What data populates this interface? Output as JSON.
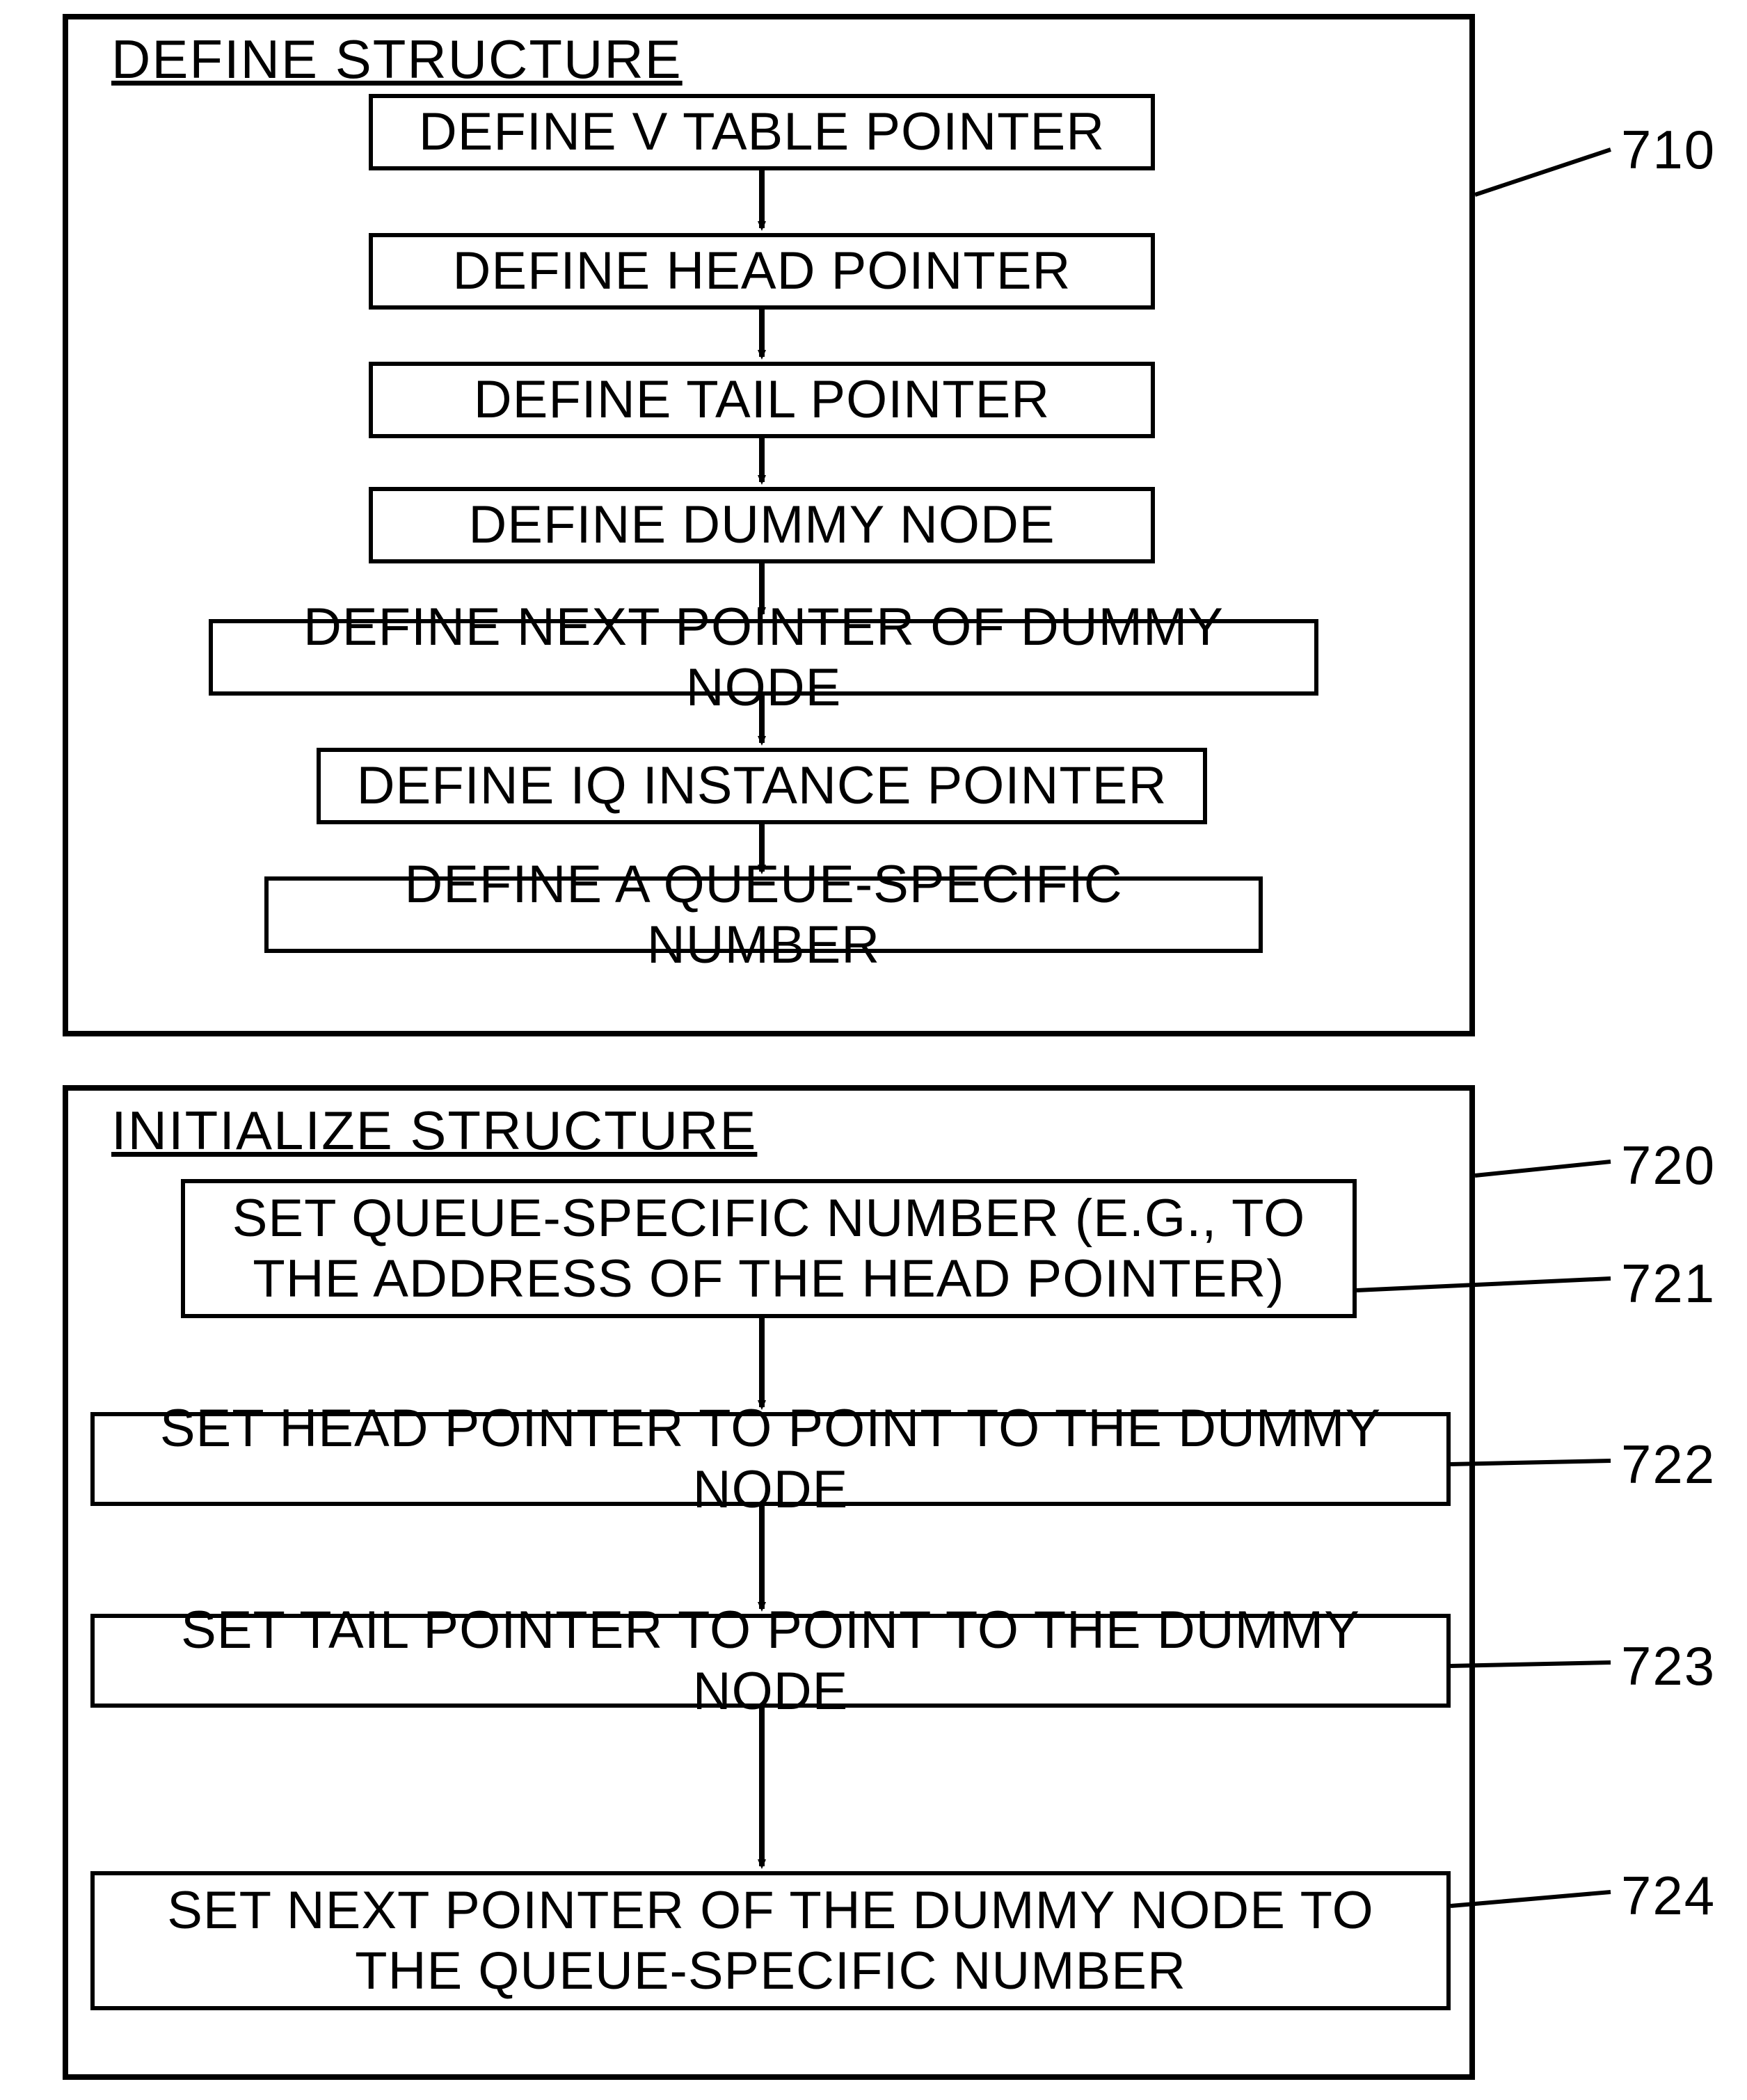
{
  "panel1": {
    "title": "DEFINE STRUCTURE",
    "callout": "710",
    "steps": {
      "s1": "DEFINE V TABLE POINTER",
      "s2": "DEFINE HEAD POINTER",
      "s3": "DEFINE TAIL POINTER",
      "s4": "DEFINE DUMMY NODE",
      "s5": "DEFINE NEXT POINTER OF DUMMY NODE",
      "s6": "DEFINE IQ INSTANCE POINTER",
      "s7": "DEFINE A QUEUE-SPECIFIC NUMBER"
    }
  },
  "panel2": {
    "title": "INITIALIZE STRUCTURE",
    "callouts": {
      "c720": "720",
      "c721": "721",
      "c722": "722",
      "c723": "723",
      "c724": "724"
    },
    "steps": {
      "s1": "SET QUEUE-SPECIFIC NUMBER (E.G., TO THE ADDRESS OF THE HEAD POINTER)",
      "s2": "SET HEAD POINTER TO POINT TO THE DUMMY  NODE",
      "s3": "SET TAIL POINTER TO POINT TO THE DUMMY  NODE",
      "s4": "SET NEXT POINTER OF THE DUMMY  NODE TO THE QUEUE-SPECIFIC NUMBER"
    }
  }
}
